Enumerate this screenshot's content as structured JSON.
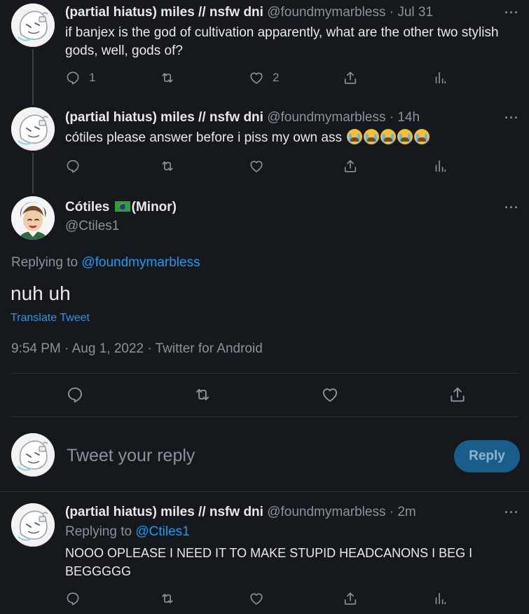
{
  "tweet1": {
    "name": "(partial hiatus) miles // nsfw dni",
    "handle": "@foundmymarbless",
    "sep": "·",
    "time": "Jul 31",
    "text": "if banjex is the god of cultivation apparently, what are the other two stylish gods, well, gods of?",
    "reply_count": "1",
    "like_count": "2",
    "more": "···"
  },
  "tweet2": {
    "name": "(partial hiatus) miles // nsfw dni",
    "handle": "@foundmymarbless",
    "sep": "·",
    "time": "14h",
    "text": "cótiles please answer before i piss my own ass",
    "emoji_name": "loudly-crying-face",
    "more": "···"
  },
  "main_tweet": {
    "name": "Cótiles",
    "flag": "brazil-flag",
    "name_suffix": "(Minor)",
    "handle": "@Ctiles1",
    "replying_prefix": "Replying to",
    "replying_to": "@foundmymarbless",
    "text": "nuh uh",
    "translate": "Translate Tweet",
    "time": "9:54 PM",
    "date": "Aug 1, 2022",
    "source": "Twitter for Android",
    "sep": "·",
    "more": "···"
  },
  "reply_box": {
    "placeholder": "Tweet your reply",
    "button": "Reply"
  },
  "tweet3": {
    "name": "(partial hiatus) miles // nsfw dni",
    "handle": "@foundmymarbless",
    "sep": "·",
    "time": "2m",
    "replying_prefix": "Replying to",
    "replying_to": "@Ctiles1",
    "text": "NOOO OPLEASE I NEED IT TO MAKE STUPID HEADCANONS I BEG I BEGGGGG",
    "more": "···"
  },
  "colors": {
    "background": "#15181c",
    "accent": "#1d9bf0",
    "muted": "#8b9299"
  }
}
